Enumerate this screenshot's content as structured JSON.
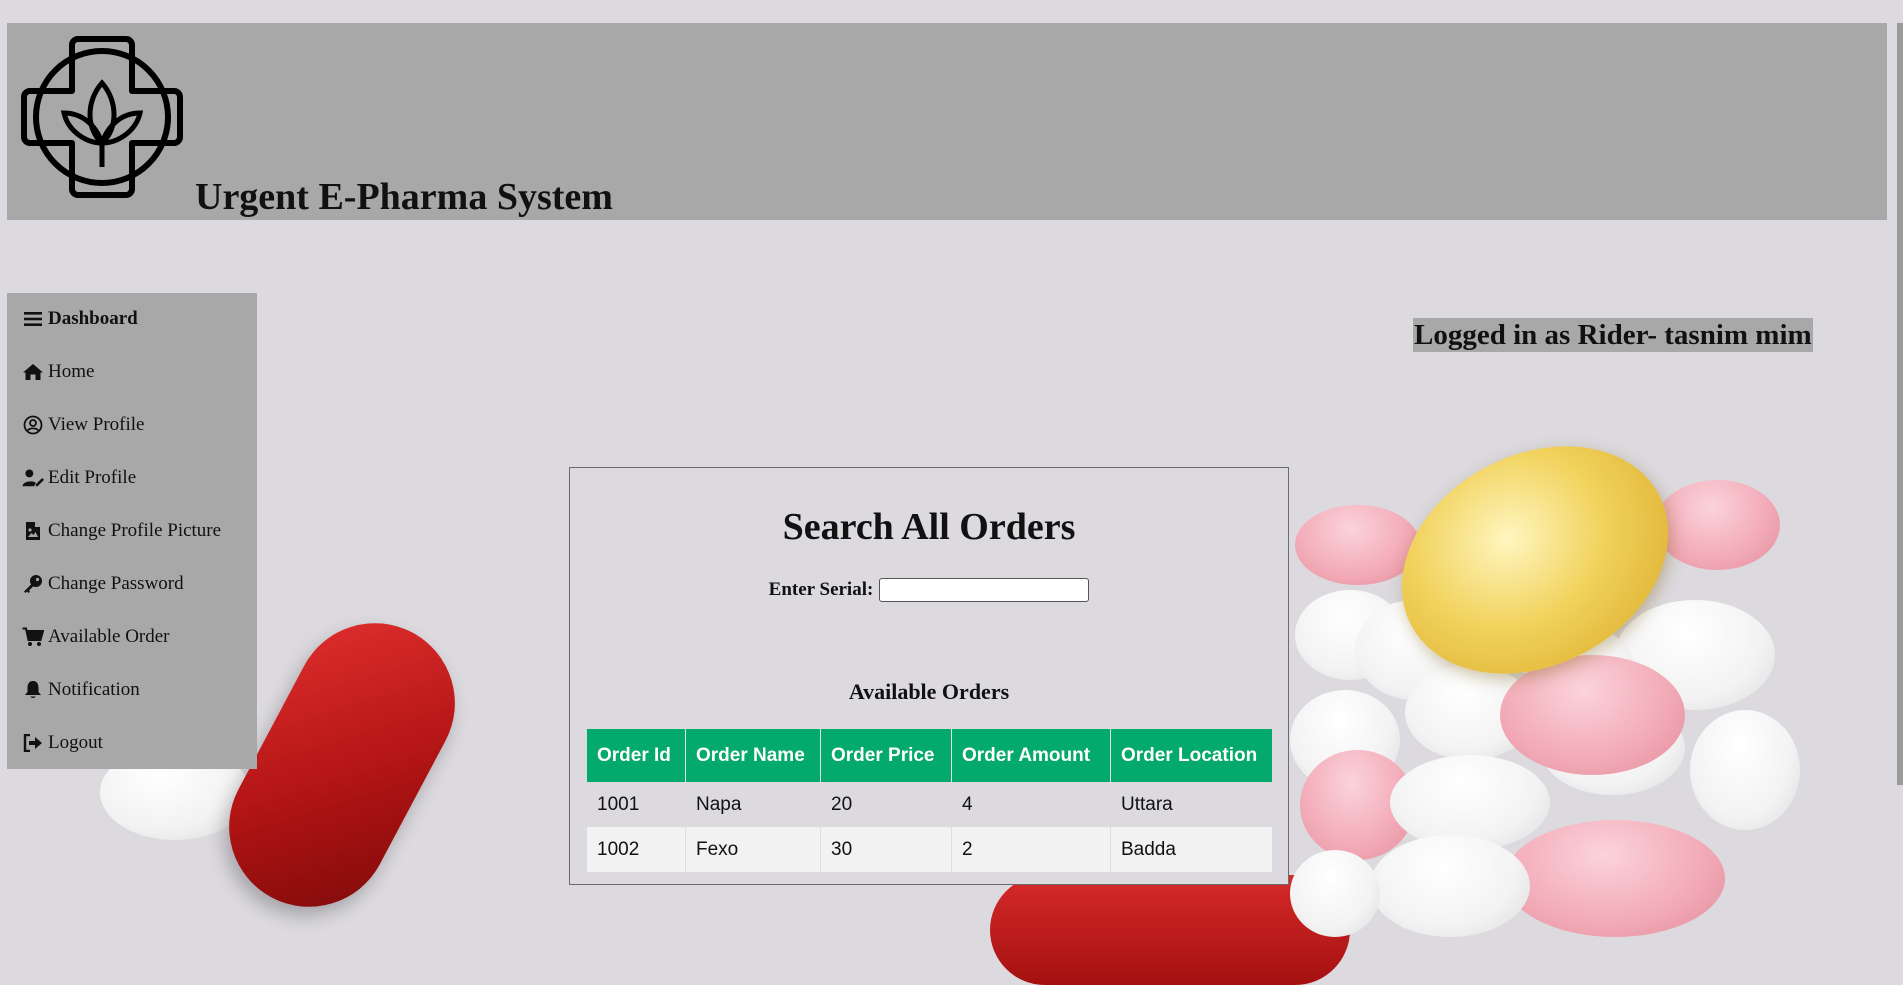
{
  "header": {
    "title": "Urgent E-Pharma System",
    "logo_icon": "pharmacy-cross-leaf-logo"
  },
  "sidebar": {
    "items": [
      {
        "label": "Dashboard",
        "icon": "menu-icon"
      },
      {
        "label": "Home",
        "icon": "home-icon"
      },
      {
        "label": "View Profile",
        "icon": "user-circle-icon"
      },
      {
        "label": "Edit Profile",
        "icon": "user-edit-icon"
      },
      {
        "label": "Change Profile Picture",
        "icon": "file-image-icon"
      },
      {
        "label": "Change Password",
        "icon": "key-icon"
      },
      {
        "label": "Available Order",
        "icon": "cart-icon"
      },
      {
        "label": "Notification",
        "icon": "bell-icon"
      },
      {
        "label": "Logout",
        "icon": "logout-icon"
      }
    ]
  },
  "user_status": {
    "text": "Logged in as Rider- tasnim mim"
  },
  "search": {
    "title": "Search All Orders",
    "serial_label": "Enter Serial:",
    "serial_value": ""
  },
  "orders": {
    "caption": "Available Orders",
    "columns": [
      "Order Id",
      "Order Name",
      "Order Price",
      "Order Amount",
      "Order Location"
    ],
    "rows": [
      [
        "1001",
        "Napa",
        "20",
        "4",
        "Uttara"
      ],
      [
        "1002",
        "Fexo",
        "30",
        "2",
        "Badda"
      ]
    ]
  },
  "colors": {
    "header_bg": "#a8a8a8",
    "table_header": "#04aa6d",
    "page_bg": "#dcdadf"
  }
}
